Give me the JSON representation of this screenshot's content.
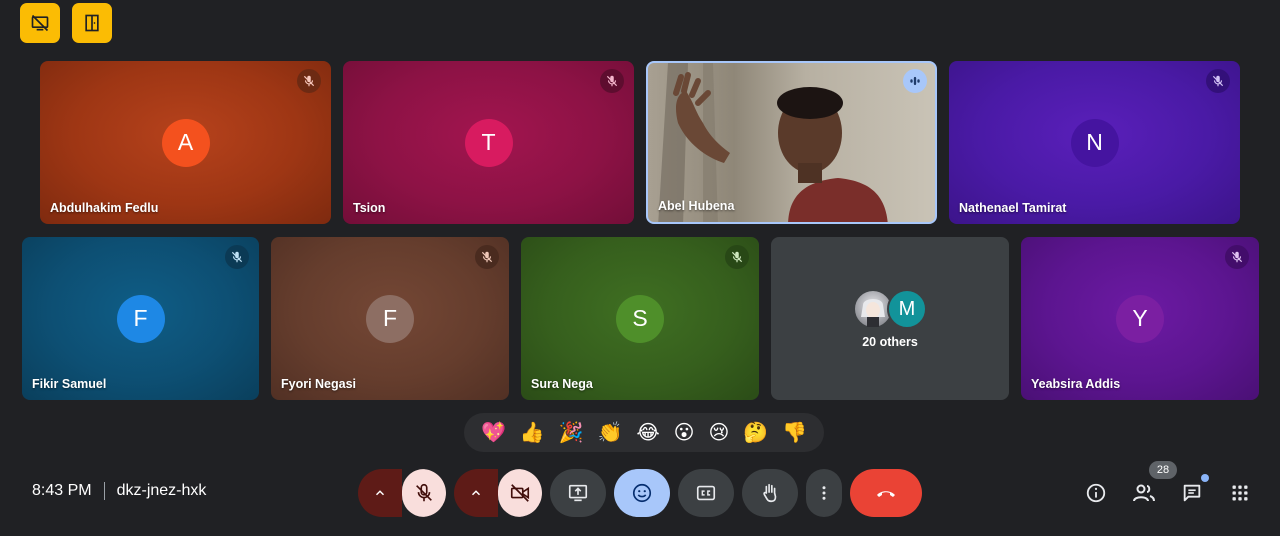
{
  "participants_row1": [
    {
      "name": "Abdulhakim Fedlu",
      "initial": "A"
    },
    {
      "name": "Tsion",
      "initial": "T"
    },
    {
      "name": "Abel Hubena",
      "initial": ""
    },
    {
      "name": "Nathenael Tamirat",
      "initial": "N"
    }
  ],
  "participants_row2": [
    {
      "name": "Fikir Samuel",
      "initial": "F"
    },
    {
      "name": "Fyori Negasi",
      "initial": "F"
    },
    {
      "name": "Sura Nega",
      "initial": "S"
    },
    {
      "name": "Yeabsira Addis",
      "initial": "Y"
    }
  ],
  "others": {
    "label": "20 others",
    "avatar_initial": "M"
  },
  "reactions": [
    "💖",
    "👍",
    "🎉",
    "👏",
    "😂",
    "😮",
    "😢",
    "🤔",
    "👎"
  ],
  "meeting": {
    "time": "8:43 PM",
    "code": "dkz-jnez-hxk"
  },
  "people_count": "28",
  "colors": {
    "background": "#202124",
    "mic_off_bg": "#f9dedc",
    "arrow_bg": "#5e1b17",
    "end_call": "#ea4335",
    "reactions_active": "#a8c7fa",
    "badge_yellow": "#fbbc04"
  },
  "icons": {
    "top_left_1": "screen-share-off-icon",
    "top_left_2": "door-icon",
    "mic": "mic-off-icon",
    "camera": "video-off-icon",
    "present": "present-screen-icon",
    "emoji": "emoji-icon",
    "captions": "closed-captions-icon",
    "hand": "raise-hand-icon",
    "more": "more-vert-icon",
    "end": "call-end-icon",
    "info": "info-icon",
    "people": "people-icon",
    "chat": "chat-icon",
    "activities": "apps-grid-icon"
  }
}
